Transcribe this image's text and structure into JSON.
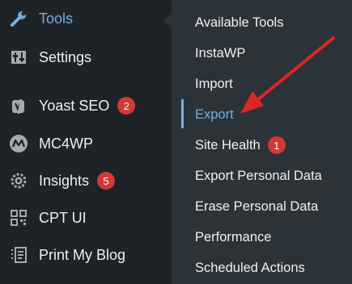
{
  "sidebar": {
    "items": [
      {
        "label": "Tools",
        "icon": "wrench-icon"
      },
      {
        "label": "Settings",
        "icon": "settings-sliders-icon"
      },
      {
        "label": "Yoast SEO",
        "icon": "yoast-icon",
        "badge": "2"
      },
      {
        "label": "MC4WP",
        "icon": "mc4wp-icon"
      },
      {
        "label": "Insights",
        "icon": "insights-gear-icon",
        "badge": "5"
      },
      {
        "label": "CPT UI",
        "icon": "cpt-ui-icon"
      },
      {
        "label": "Print My Blog",
        "icon": "print-blog-icon"
      }
    ]
  },
  "submenu": {
    "items": [
      {
        "label": "Available Tools"
      },
      {
        "label": "InstaWP"
      },
      {
        "label": "Import"
      },
      {
        "label": "Export"
      },
      {
        "label": "Site Health",
        "badge": "1"
      },
      {
        "label": "Export Personal Data"
      },
      {
        "label": "Erase Personal Data"
      },
      {
        "label": "Performance"
      },
      {
        "label": "Scheduled Actions"
      }
    ]
  },
  "colors": {
    "sidebar_bg": "#1d2327",
    "submenu_bg": "#2c3338",
    "accent": "#72aee6",
    "badge": "#d63638",
    "arrow": "#e02424"
  }
}
